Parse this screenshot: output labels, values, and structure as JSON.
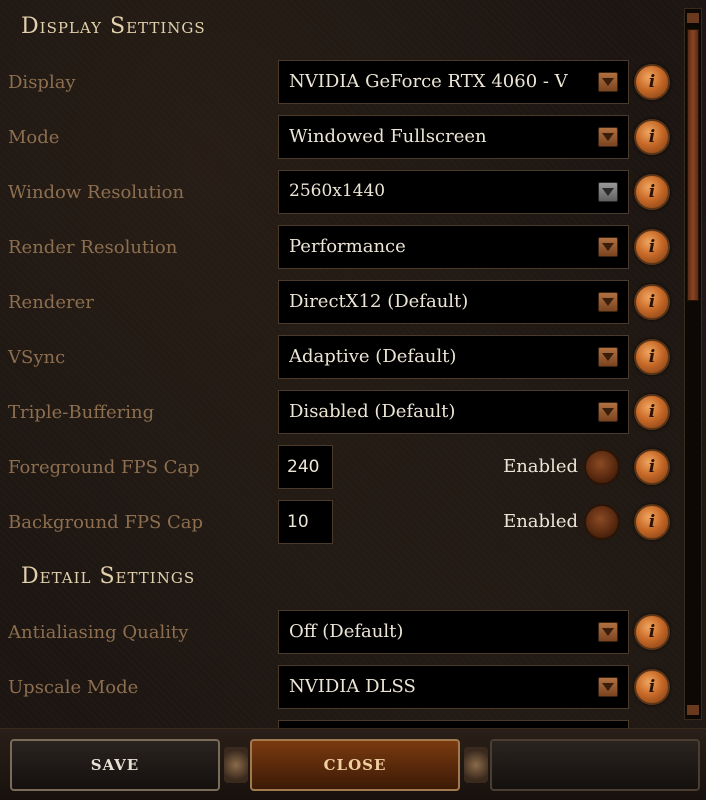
{
  "sections": {
    "display": {
      "title": "Display Settings",
      "rows": [
        {
          "label": "Display",
          "value": "NVIDIA GeForce RTX 4060 - V"
        },
        {
          "label": "Mode",
          "value": "Windowed Fullscreen"
        },
        {
          "label": "Window Resolution",
          "value": "2560x1440"
        },
        {
          "label": "Render Resolution",
          "value": "Performance"
        },
        {
          "label": "Renderer",
          "value": "DirectX12 (Default)"
        },
        {
          "label": "VSync",
          "value": "Adaptive (Default)"
        },
        {
          "label": "Triple-Buffering",
          "value": "Disabled (Default)"
        },
        {
          "label": "Foreground FPS Cap",
          "value": "240",
          "toggle_label": "Enabled"
        },
        {
          "label": "Background FPS Cap",
          "value": "10",
          "toggle_label": "Enabled"
        }
      ]
    },
    "detail": {
      "title": "Detail Settings",
      "rows": [
        {
          "label": "Antialiasing Quality",
          "value": "Off (Default)"
        },
        {
          "label": "Upscale Mode",
          "value": "NVIDIA DLSS"
        }
      ]
    }
  },
  "info_icon_glyph": "i",
  "footer": {
    "save_label": "SAVE",
    "close_label": "CLOSE"
  },
  "colors": {
    "accent": "#c86a28",
    "label": "#8d6f4f",
    "title": "#e3d1ad"
  }
}
